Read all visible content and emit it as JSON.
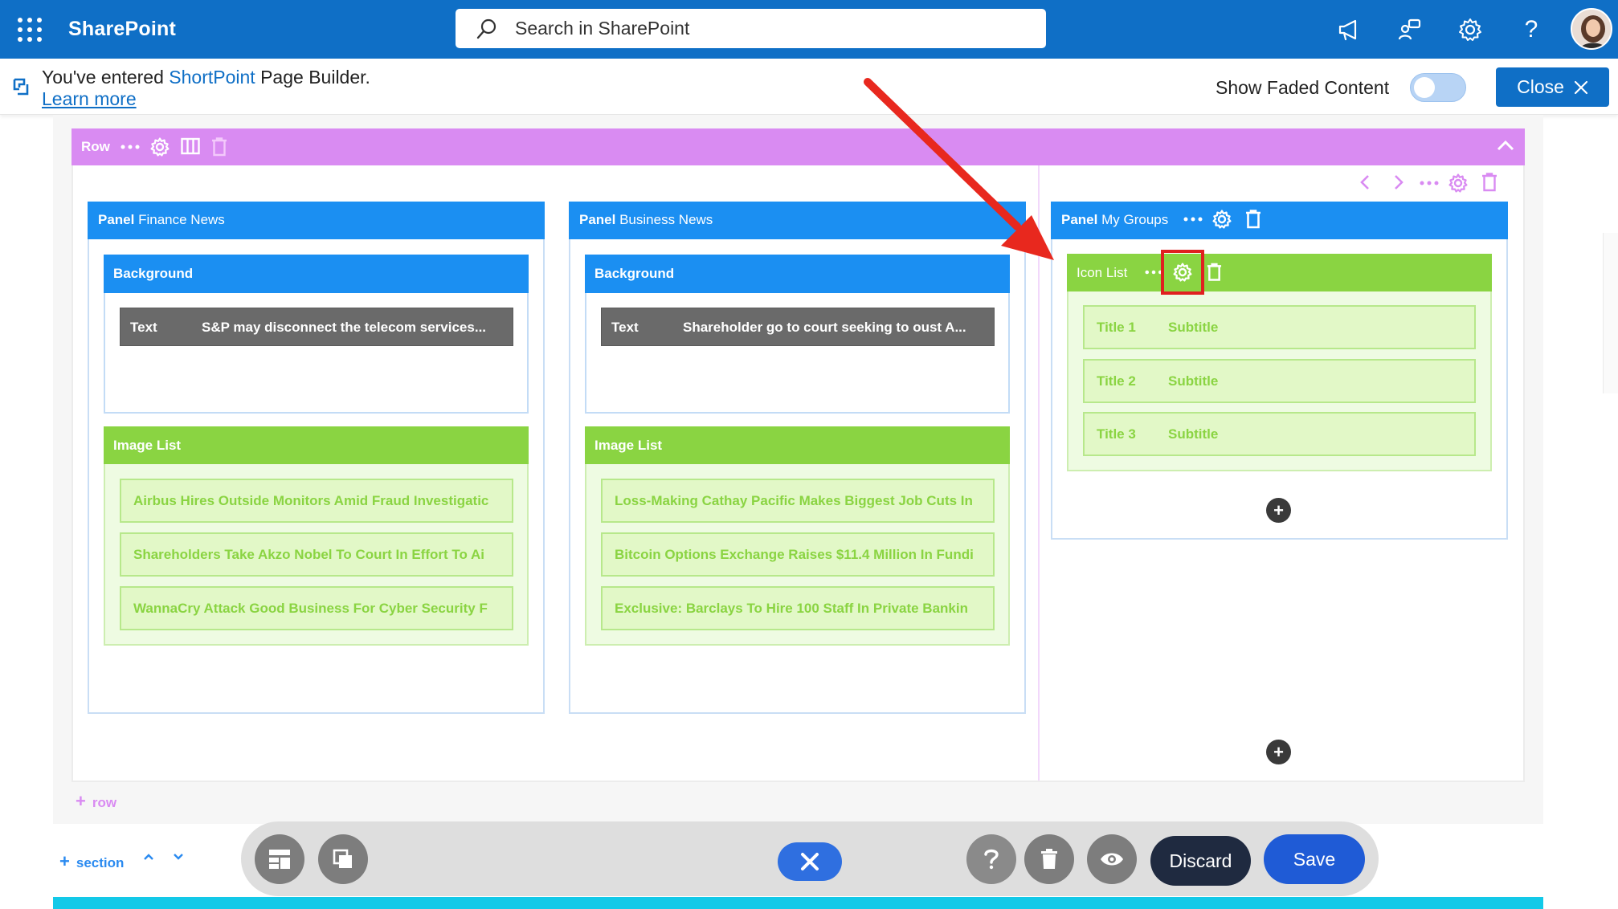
{
  "topbar": {
    "app_name": "SharePoint",
    "search_placeholder": "Search in SharePoint",
    "icons": [
      "waffle-icon",
      "megaphone-icon",
      "connection-icon",
      "gear-icon",
      "help-icon",
      "avatar"
    ],
    "help_glyph": "?"
  },
  "notice": {
    "prefix": "You've entered ",
    "brand": "ShortPoint",
    "suffix": " Page Builder.",
    "learn_more": "Learn more",
    "faded_label": "Show Faded Content",
    "faded_enabled": false,
    "close_label": "Close"
  },
  "row": {
    "label": "Row",
    "color": "#d98bf2"
  },
  "panels": [
    {
      "tag": "Panel",
      "name": "Finance News",
      "background_label": "Background",
      "text_tag": "Text",
      "text_value": "S&P may disconnect the telecom services...",
      "image_list_label": "Image List",
      "items": [
        "Airbus Hires Outside Monitors Amid Fraud Investigatic",
        "Shareholders Take Akzo Nobel To Court In Effort To Ai",
        "WannaCry Attack Good Business For Cyber Security F"
      ]
    },
    {
      "tag": "Panel",
      "name": "Business News",
      "background_label": "Background",
      "text_tag": "Text",
      "text_value": "Shareholder go to court seeking to oust A...",
      "image_list_label": "Image List",
      "items": [
        "Loss-Making Cathay Pacific Makes Biggest Job Cuts In",
        "Bitcoin Options Exchange Raises $11.4 Million In Fundi",
        "Exclusive: Barclays To Hire 100 Staff In Private Bankin"
      ]
    },
    {
      "tag": "Panel",
      "name": "My Groups",
      "icon_list_label": "Icon List",
      "items": [
        {
          "title": "Title 1",
          "subtitle": "Subtitle"
        },
        {
          "title": "Title 2",
          "subtitle": "Subtitle"
        },
        {
          "title": "Title 3",
          "subtitle": "Subtitle"
        }
      ]
    }
  ],
  "add_row_label": "row",
  "add_section_label": "section",
  "toolbar": {
    "discard_label": "Discard",
    "save_label": "Save"
  },
  "colors": {
    "suite_blue": "#0f6fc6",
    "panel_blue": "#1b8ff2",
    "green": "#8ad442",
    "annotation_red": "#e02020",
    "footer_cyan": "#13c9e8"
  }
}
